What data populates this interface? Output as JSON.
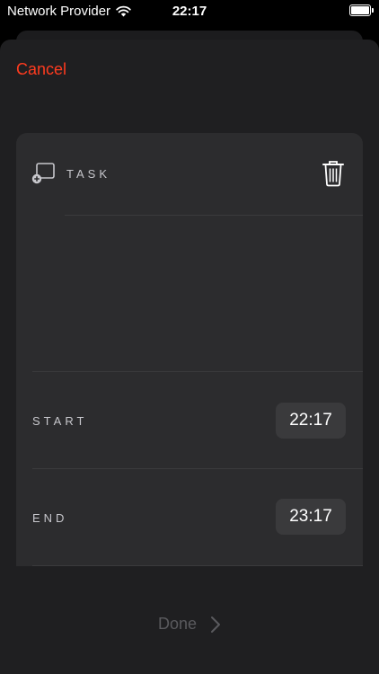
{
  "status_bar": {
    "carrier": "Network Provider",
    "time": "22:17",
    "icons": [
      "wifi-icon",
      "battery-icon"
    ]
  },
  "nav": {
    "cancel_label": "Cancel"
  },
  "task": {
    "label": "TASK",
    "icons": [
      "add-task-icon",
      "trash-icon"
    ],
    "value": "",
    "notes": ""
  },
  "start": {
    "label": "START",
    "time": "22:17"
  },
  "end": {
    "label": "END",
    "time": "23:17"
  },
  "footer": {
    "done_label": "Done",
    "icon": "chevron-right-icon"
  },
  "colors": {
    "accent": "#ff3b1f",
    "background": "#000000",
    "sheet": "#1f1f21",
    "card": "#2c2c2e",
    "pill": "#3a3a3c",
    "disabled_text": "#5a5a5e"
  }
}
